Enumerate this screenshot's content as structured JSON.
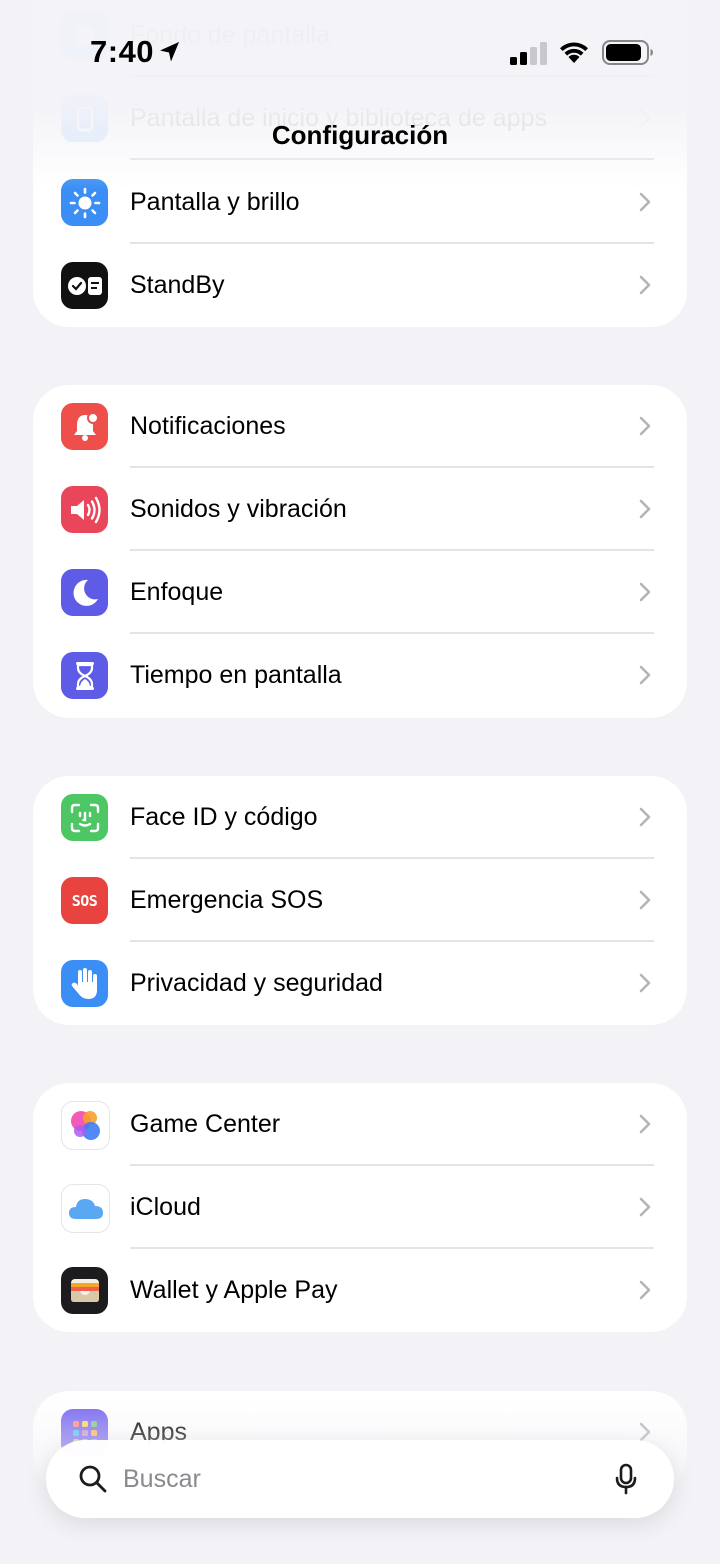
{
  "status_bar": {
    "time": "7:40",
    "icons": [
      "location-arrow-icon",
      "cellular-signal-icon",
      "wifi-icon",
      "battery-icon"
    ]
  },
  "nav": {
    "title": "Configuración"
  },
  "groups": [
    {
      "items": [
        {
          "label": "Fondo de pantalla",
          "icon": "wallpaper-icon",
          "faded": true
        },
        {
          "label": "Pantalla de inicio y biblioteca de apps",
          "icon": "home-screen-icon",
          "faded": true
        },
        {
          "label": "Pantalla y brillo",
          "icon": "sun-icon",
          "color": "#3a8ef6"
        },
        {
          "label": "StandBy",
          "icon": "standby-icon",
          "color": "#111111"
        }
      ]
    },
    {
      "items": [
        {
          "label": "Notificaciones",
          "icon": "bell-icon",
          "color": "#ef4f4a"
        },
        {
          "label": "Sonidos y vibración",
          "icon": "speaker-icon",
          "color": "#e9465b"
        },
        {
          "label": "Enfoque",
          "icon": "moon-icon",
          "color": "#5e5ce6"
        },
        {
          "label": "Tiempo en pantalla",
          "icon": "hourglass-icon",
          "color": "#5e5ce6"
        }
      ]
    },
    {
      "items": [
        {
          "label": "Face ID y código",
          "icon": "face-id-icon",
          "color": "#4cc764"
        },
        {
          "label": "Emergencia SOS",
          "icon": "sos-icon",
          "color": "#e8433f",
          "icon_text": "SOS"
        },
        {
          "label": "Privacidad y seguridad",
          "icon": "hand-icon",
          "color": "#3a8ef6"
        }
      ]
    },
    {
      "items": [
        {
          "label": "Game Center",
          "icon": "game-center-icon"
        },
        {
          "label": "iCloud",
          "icon": "cloud-icon"
        },
        {
          "label": "Wallet y Apple Pay",
          "icon": "wallet-icon",
          "color": "#1c1c1e"
        }
      ]
    },
    {
      "items": [
        {
          "label": "Apps",
          "icon": "apps-grid-icon",
          "color": "#7d6cf0"
        }
      ]
    }
  ],
  "search": {
    "placeholder": "Buscar"
  }
}
